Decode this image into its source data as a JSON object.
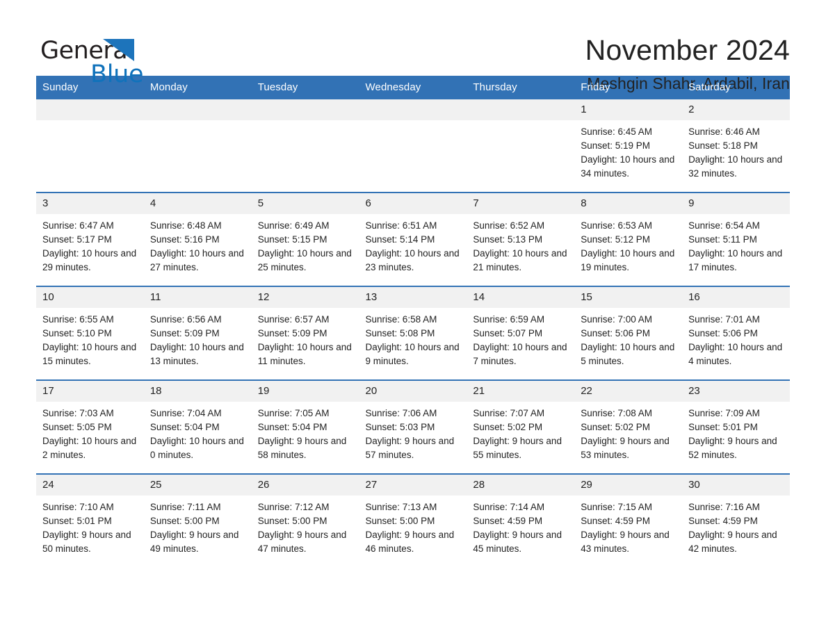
{
  "brand": {
    "word_general": "General",
    "word_blue": "Blue",
    "triangle_color": "#1d74bb"
  },
  "header": {
    "title": "November 2024",
    "subtitle": "Meshgin Shahr, Ardabil, Iran"
  },
  "theme": {
    "header_blue": "#3272b5",
    "daynum_band": "#f1f1f1",
    "text": "#222222"
  },
  "calendar": {
    "weekday_headers": [
      "Sunday",
      "Monday",
      "Tuesday",
      "Wednesday",
      "Thursday",
      "Friday",
      "Saturday"
    ],
    "labels": {
      "sunrise_prefix": "Sunrise:",
      "sunset_prefix": "Sunset:",
      "daylight_prefix": "Daylight:"
    },
    "weeks": [
      [
        {
          "day": "",
          "empty": true
        },
        {
          "day": "",
          "empty": true
        },
        {
          "day": "",
          "empty": true
        },
        {
          "day": "",
          "empty": true
        },
        {
          "day": "",
          "empty": true
        },
        {
          "day": "1",
          "sunrise": "Sunrise: 6:45 AM",
          "sunset": "Sunset: 5:19 PM",
          "daylight": "Daylight: 10 hours and 34 minutes."
        },
        {
          "day": "2",
          "sunrise": "Sunrise: 6:46 AM",
          "sunset": "Sunset: 5:18 PM",
          "daylight": "Daylight: 10 hours and 32 minutes."
        }
      ],
      [
        {
          "day": "3",
          "sunrise": "Sunrise: 6:47 AM",
          "sunset": "Sunset: 5:17 PM",
          "daylight": "Daylight: 10 hours and 29 minutes."
        },
        {
          "day": "4",
          "sunrise": "Sunrise: 6:48 AM",
          "sunset": "Sunset: 5:16 PM",
          "daylight": "Daylight: 10 hours and 27 minutes."
        },
        {
          "day": "5",
          "sunrise": "Sunrise: 6:49 AM",
          "sunset": "Sunset: 5:15 PM",
          "daylight": "Daylight: 10 hours and 25 minutes."
        },
        {
          "day": "6",
          "sunrise": "Sunrise: 6:51 AM",
          "sunset": "Sunset: 5:14 PM",
          "daylight": "Daylight: 10 hours and 23 minutes."
        },
        {
          "day": "7",
          "sunrise": "Sunrise: 6:52 AM",
          "sunset": "Sunset: 5:13 PM",
          "daylight": "Daylight: 10 hours and 21 minutes."
        },
        {
          "day": "8",
          "sunrise": "Sunrise: 6:53 AM",
          "sunset": "Sunset: 5:12 PM",
          "daylight": "Daylight: 10 hours and 19 minutes."
        },
        {
          "day": "9",
          "sunrise": "Sunrise: 6:54 AM",
          "sunset": "Sunset: 5:11 PM",
          "daylight": "Daylight: 10 hours and 17 minutes."
        }
      ],
      [
        {
          "day": "10",
          "sunrise": "Sunrise: 6:55 AM",
          "sunset": "Sunset: 5:10 PM",
          "daylight": "Daylight: 10 hours and 15 minutes."
        },
        {
          "day": "11",
          "sunrise": "Sunrise: 6:56 AM",
          "sunset": "Sunset: 5:09 PM",
          "daylight": "Daylight: 10 hours and 13 minutes."
        },
        {
          "day": "12",
          "sunrise": "Sunrise: 6:57 AM",
          "sunset": "Sunset: 5:09 PM",
          "daylight": "Daylight: 10 hours and 11 minutes."
        },
        {
          "day": "13",
          "sunrise": "Sunrise: 6:58 AM",
          "sunset": "Sunset: 5:08 PM",
          "daylight": "Daylight: 10 hours and 9 minutes."
        },
        {
          "day": "14",
          "sunrise": "Sunrise: 6:59 AM",
          "sunset": "Sunset: 5:07 PM",
          "daylight": "Daylight: 10 hours and 7 minutes."
        },
        {
          "day": "15",
          "sunrise": "Sunrise: 7:00 AM",
          "sunset": "Sunset: 5:06 PM",
          "daylight": "Daylight: 10 hours and 5 minutes."
        },
        {
          "day": "16",
          "sunrise": "Sunrise: 7:01 AM",
          "sunset": "Sunset: 5:06 PM",
          "daylight": "Daylight: 10 hours and 4 minutes."
        }
      ],
      [
        {
          "day": "17",
          "sunrise": "Sunrise: 7:03 AM",
          "sunset": "Sunset: 5:05 PM",
          "daylight": "Daylight: 10 hours and 2 minutes."
        },
        {
          "day": "18",
          "sunrise": "Sunrise: 7:04 AM",
          "sunset": "Sunset: 5:04 PM",
          "daylight": "Daylight: 10 hours and 0 minutes."
        },
        {
          "day": "19",
          "sunrise": "Sunrise: 7:05 AM",
          "sunset": "Sunset: 5:04 PM",
          "daylight": "Daylight: 9 hours and 58 minutes."
        },
        {
          "day": "20",
          "sunrise": "Sunrise: 7:06 AM",
          "sunset": "Sunset: 5:03 PM",
          "daylight": "Daylight: 9 hours and 57 minutes."
        },
        {
          "day": "21",
          "sunrise": "Sunrise: 7:07 AM",
          "sunset": "Sunset: 5:02 PM",
          "daylight": "Daylight: 9 hours and 55 minutes."
        },
        {
          "day": "22",
          "sunrise": "Sunrise: 7:08 AM",
          "sunset": "Sunset: 5:02 PM",
          "daylight": "Daylight: 9 hours and 53 minutes."
        },
        {
          "day": "23",
          "sunrise": "Sunrise: 7:09 AM",
          "sunset": "Sunset: 5:01 PM",
          "daylight": "Daylight: 9 hours and 52 minutes."
        }
      ],
      [
        {
          "day": "24",
          "sunrise": "Sunrise: 7:10 AM",
          "sunset": "Sunset: 5:01 PM",
          "daylight": "Daylight: 9 hours and 50 minutes."
        },
        {
          "day": "25",
          "sunrise": "Sunrise: 7:11 AM",
          "sunset": "Sunset: 5:00 PM",
          "daylight": "Daylight: 9 hours and 49 minutes."
        },
        {
          "day": "26",
          "sunrise": "Sunrise: 7:12 AM",
          "sunset": "Sunset: 5:00 PM",
          "daylight": "Daylight: 9 hours and 47 minutes."
        },
        {
          "day": "27",
          "sunrise": "Sunrise: 7:13 AM",
          "sunset": "Sunset: 5:00 PM",
          "daylight": "Daylight: 9 hours and 46 minutes."
        },
        {
          "day": "28",
          "sunrise": "Sunrise: 7:14 AM",
          "sunset": "Sunset: 4:59 PM",
          "daylight": "Daylight: 9 hours and 45 minutes."
        },
        {
          "day": "29",
          "sunrise": "Sunrise: 7:15 AM",
          "sunset": "Sunset: 4:59 PM",
          "daylight": "Daylight: 9 hours and 43 minutes."
        },
        {
          "day": "30",
          "sunrise": "Sunrise: 7:16 AM",
          "sunset": "Sunset: 4:59 PM",
          "daylight": "Daylight: 9 hours and 42 minutes."
        }
      ]
    ]
  }
}
